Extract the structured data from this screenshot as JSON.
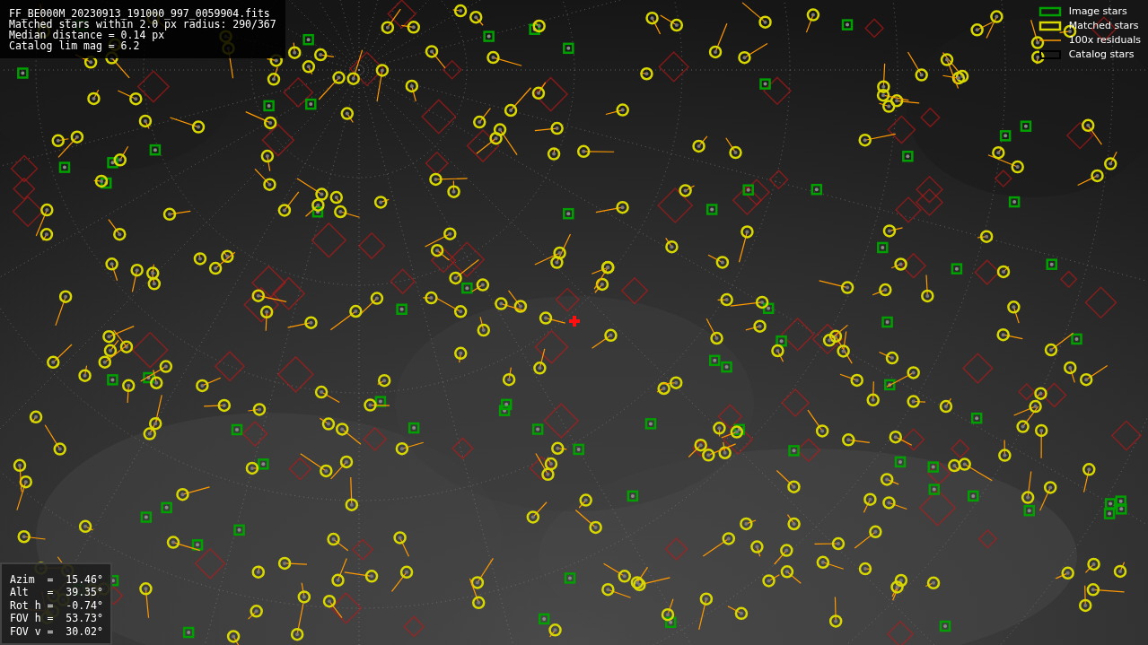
{
  "file_info": {
    "lines": [
      "FF_BE000M_20230913_191000_997_0059904.fits",
      "Matched stars within 2.0 px radius: 290/367",
      "Median distance = 0.14 px",
      "Catalog lim mag = 6.2"
    ]
  },
  "legend": [
    {
      "label": "Image stars"
    },
    {
      "label": "Matched stars",
      "kind": "matched"
    },
    {
      "label": "100x residuals",
      "kind": "residual"
    },
    {
      "label": "Catalog stars",
      "kind": "catalog"
    }
  ],
  "pointing": {
    "rows": [
      "Azim  =  15.46°",
      "Alt   =  39.35°",
      "Rot h =  -0.74°",
      "FOV h =  53.73°",
      "FOV v =  30.02°"
    ]
  }
}
